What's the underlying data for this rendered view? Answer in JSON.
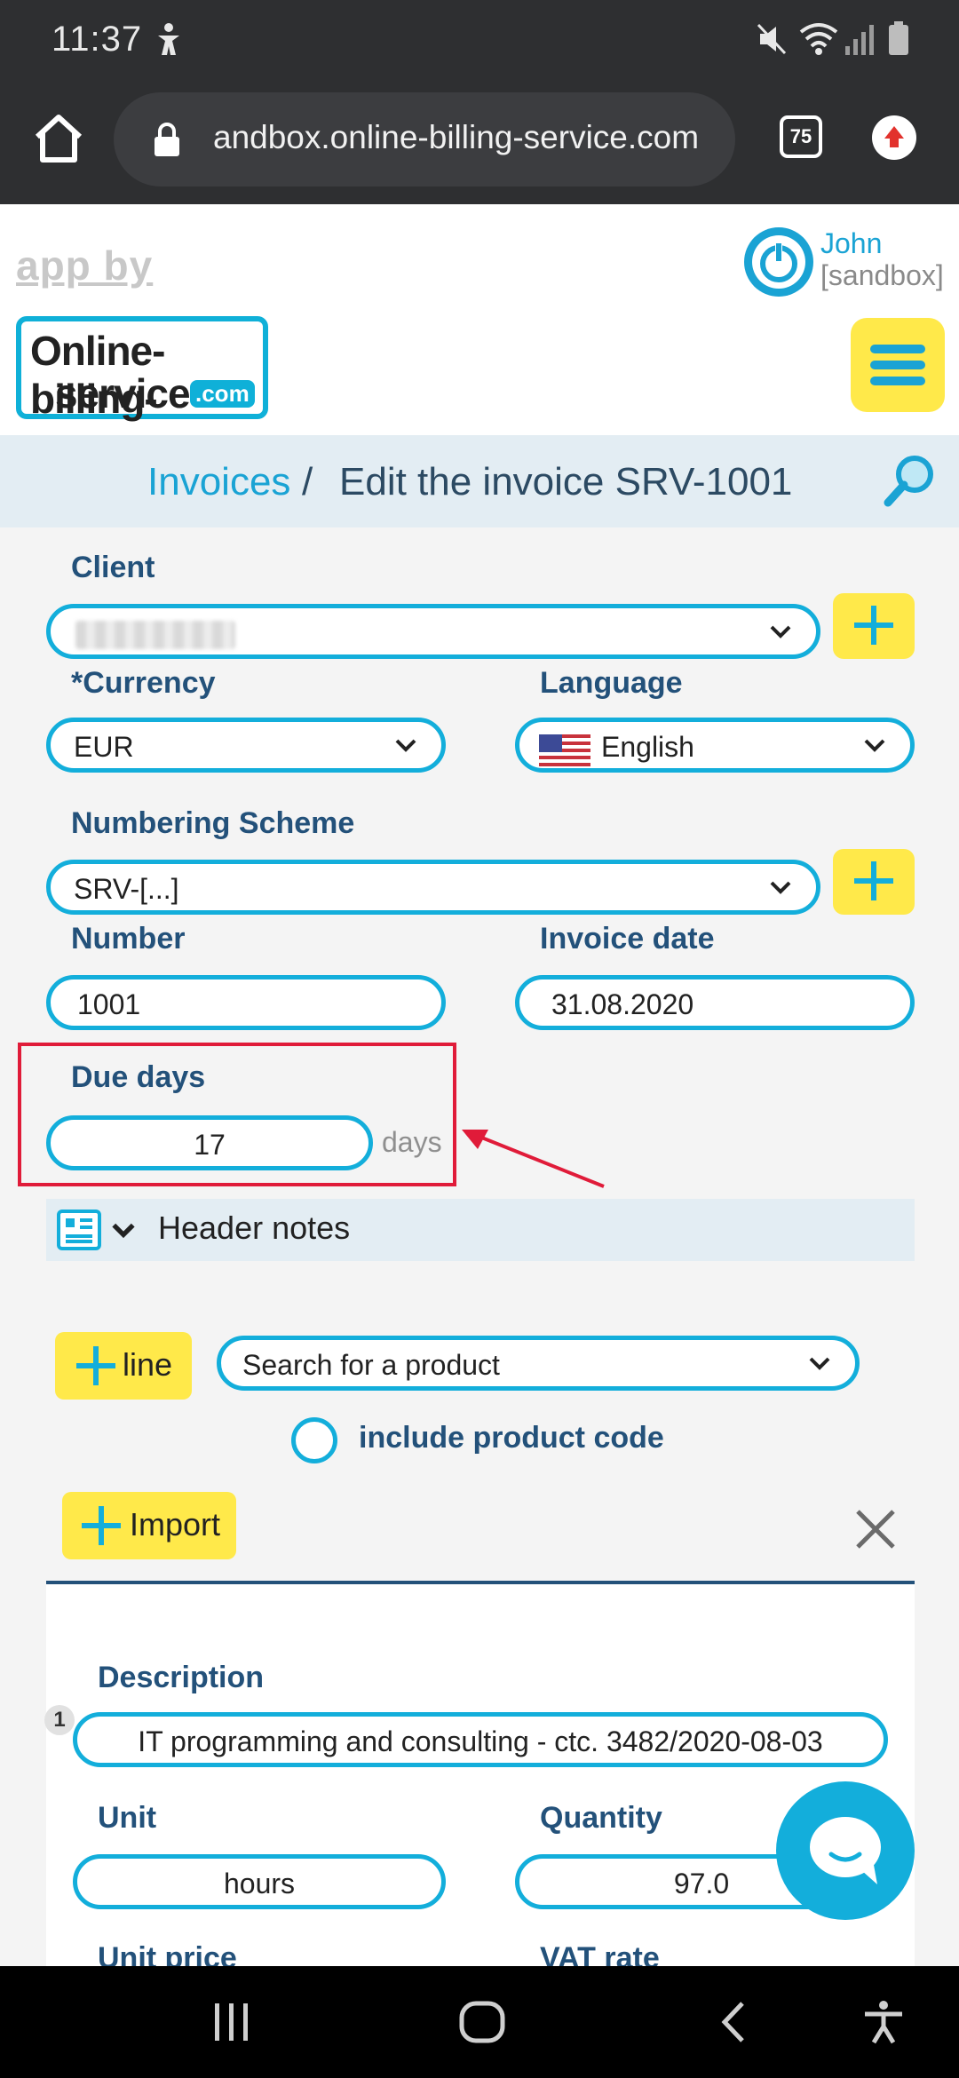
{
  "status": {
    "time": "11:37"
  },
  "browser": {
    "url": "andbox.online-billing-service.com",
    "tab_count": "75"
  },
  "header": {
    "app_by": "app by",
    "logo_line1": "Online-billing-",
    "logo_line2": "service",
    "logo_dotcom": ".com",
    "user_name": "John",
    "user_sub": "[sandbox]"
  },
  "breadcrumb": {
    "link": "Invoices",
    "separator": "/",
    "current": "Edit the invoice SRV-1001"
  },
  "form": {
    "client_label": "Client",
    "currency_label": "*Currency",
    "currency_value": "EUR",
    "language_label": "Language",
    "language_value": "English",
    "numbering_label": "Numbering Scheme",
    "numbering_value": "SRV-[...]",
    "number_label": "Number",
    "number_value": "1001",
    "invoice_date_label": "Invoice date",
    "invoice_date_value": "31.08.2020",
    "due_days_label": "Due days",
    "due_days_value": "17",
    "due_days_unit": "days",
    "header_notes_label": "Header notes"
  },
  "lines": {
    "add_line_label": "line",
    "product_search_placeholder": "Search for a product",
    "include_code_label": "include product code",
    "import_label": "Import",
    "line_number": "1",
    "description_label": "Description",
    "description_value": "IT programming and consulting - ctc. 3482/2020-08-03",
    "unit_label": "Unit",
    "unit_value": "hours",
    "quantity_label": "Quantity",
    "quantity_value": "97.0",
    "unit_price_label": "Unit price",
    "vat_rate_label": "VAT rate"
  },
  "colors": {
    "accent": "#13aedb",
    "label": "#23517a",
    "highlight": "#ffe94a",
    "annotation": "#e01b39"
  }
}
